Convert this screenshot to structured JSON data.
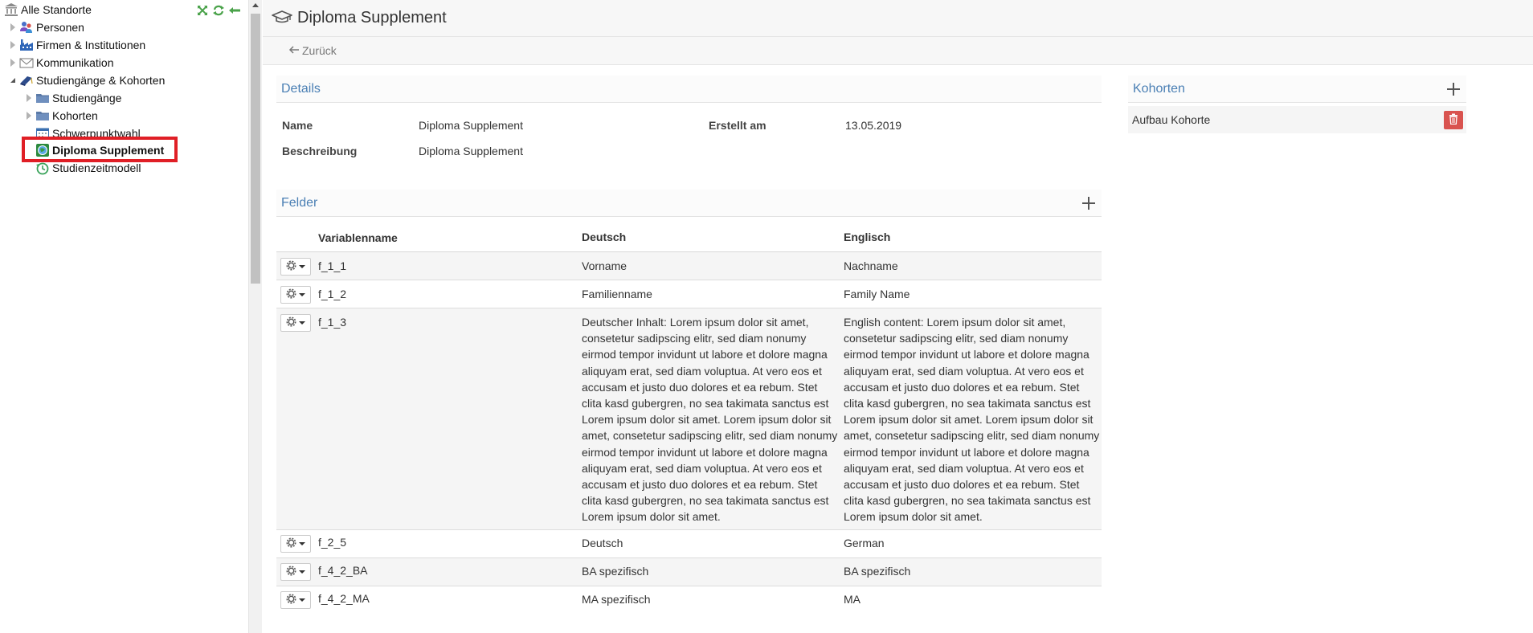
{
  "sidebar": {
    "root_label": "Alle Standorte",
    "items": [
      {
        "label": "Personen",
        "icon": "people-icon"
      },
      {
        "label": "Firmen & Institutionen",
        "icon": "factory-icon"
      },
      {
        "label": "Kommunikation",
        "icon": "envelope-icon"
      },
      {
        "label": "Studiengänge & Kohorten",
        "icon": "graduation-cap-icon"
      },
      {
        "label": "Studiengänge",
        "icon": "folder-icon"
      },
      {
        "label": "Kohorten",
        "icon": "folder-icon"
      },
      {
        "label": "Schwerpunktwahl",
        "icon": "calendar-icon"
      },
      {
        "label": "Diploma Supplement",
        "icon": "globe-certificate-icon"
      },
      {
        "label": "Studienzeitmodell",
        "icon": "clock-history-icon"
      }
    ],
    "colors": {
      "highlight": "#e01f26"
    }
  },
  "header": {
    "title": "Diploma Supplement",
    "back_label": "Zurück"
  },
  "details": {
    "heading": "Details",
    "name_label": "Name",
    "name_value": "Diploma Supplement",
    "description_label": "Beschreibung",
    "description_value": "Diploma Supplement",
    "created_label": "Erstellt am",
    "created_value": "13.05.2019"
  },
  "fields": {
    "heading": "Felder",
    "columns": [
      "Variablenname",
      "Deutsch",
      "Englisch"
    ],
    "rows": [
      {
        "var": "f_1_1",
        "de": "Vorname",
        "en": "Nachname"
      },
      {
        "var": "f_1_2",
        "de": "Familienname",
        "en": "Family Name"
      },
      {
        "var": "f_1_3",
        "de": "Deutscher Inhalt: Lorem ipsum dolor sit amet, consetetur sadipscing elitr, sed diam nonumy eirmod tempor invidunt ut labore et dolore magna aliquyam erat, sed diam voluptua. At vero eos et accusam et justo duo dolores et ea rebum. Stet clita kasd gubergren, no sea takimata sanctus est Lorem ipsum dolor sit amet. Lorem ipsum dolor sit amet, consetetur sadipscing elitr, sed diam nonumy eirmod tempor invidunt ut labore et dolore magna aliquyam erat, sed diam voluptua. At vero eos et accusam et justo duo dolores et ea rebum. Stet clita kasd gubergren, no sea takimata sanctus est Lorem ipsum dolor sit amet.",
        "en": "English content: Lorem ipsum dolor sit amet, consetetur sadipscing elitr, sed diam nonumy eirmod tempor invidunt ut labore et dolore magna aliquyam erat, sed diam voluptua. At vero eos et accusam et justo duo dolores et ea rebum. Stet clita kasd gubergren, no sea takimata sanctus est Lorem ipsum dolor sit amet. Lorem ipsum dolor sit amet, consetetur sadipscing elitr, sed diam nonumy eirmod tempor invidunt ut labore et dolore magna aliquyam erat, sed diam voluptua. At vero eos et accusam et justo duo dolores et ea rebum. Stet clita kasd gubergren, no sea takimata sanctus est Lorem ipsum dolor sit amet."
      },
      {
        "var": "f_2_5",
        "de": "Deutsch",
        "en": "German"
      },
      {
        "var": "f_4_2_BA",
        "de": "BA spezifisch",
        "en": "BA spezifisch"
      },
      {
        "var": "f_4_2_MA",
        "de": "MA spezifisch",
        "en": "MA"
      }
    ]
  },
  "kohorten": {
    "heading": "Kohorten",
    "items": [
      {
        "label": "Aufbau Kohorte"
      }
    ],
    "colors": {
      "delete": "#d9534f",
      "heading": "#4a7fb4"
    }
  }
}
